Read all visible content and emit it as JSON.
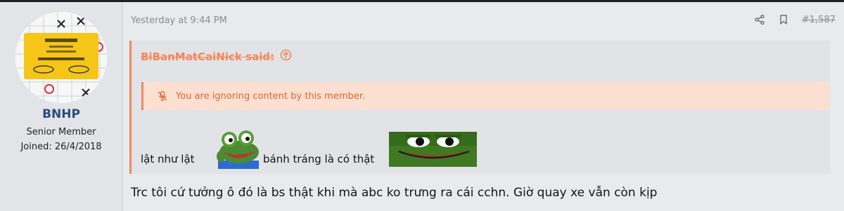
{
  "user": {
    "avatar_icon": "frog-game-avatar-icon",
    "username": "BNHP",
    "title": "Senior Member",
    "joined": "Joined: 26/4/2018"
  },
  "post": {
    "date": "Yesterday at 9:44 PM",
    "number": "#1,587",
    "actions": [
      "share-icon",
      "bookmark-icon"
    ]
  },
  "quote": {
    "author": "BiBanMatCaiNick said:",
    "ignore_message": "You are ignoring content by this member.",
    "text_1": "lật như lật",
    "text_2": "bánh tráng là có thật",
    "emotes": [
      "laughing-frog-emote",
      "smug-frog-emote"
    ]
  },
  "body": {
    "text": "Trc tôi cứ tưởng ô đó là bs thật khi mà abc ko trưng ra cái cchn. Giờ quay xe vẫn còn kịp"
  },
  "colors": {
    "accent": "#f0885a",
    "username": "#2b4b7a",
    "ignore_bg": "#fbe0d2",
    "ignore_text": "#e2632e"
  }
}
